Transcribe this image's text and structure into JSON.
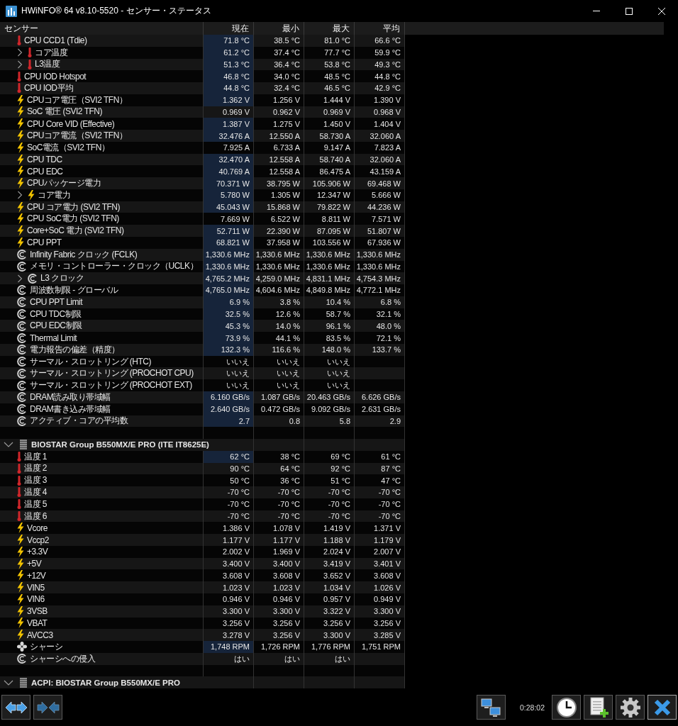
{
  "window": {
    "title": "HWiNFO® 64 v8.10-5520 - センサー・ステータス"
  },
  "columns": [
    "センサー",
    "現在",
    "最小",
    "最大",
    "平均"
  ],
  "sections": [
    {
      "rows": [
        {
          "kind": "temperature",
          "label": "CPU CCD1 (Tdie)",
          "collapsed": false,
          "current": "71.8 °C",
          "min": "38.5 °C",
          "max": "81.0 °C",
          "avg": "66.6 °C",
          "highlighted": true
        },
        {
          "kind": "temperature",
          "label": "コア温度",
          "collapsed": true,
          "current": "61.2 °C",
          "min": "37.4 °C",
          "max": "77.7 °C",
          "avg": "59.9 °C",
          "highlighted": true
        },
        {
          "kind": "temperature",
          "label": "L3温度",
          "collapsed": true,
          "current": "51.3 °C",
          "min": "36.4 °C",
          "max": "53.8 °C",
          "avg": "49.3 °C",
          "highlighted": true
        },
        {
          "kind": "temperature",
          "label": "CPU IOD Hotspot",
          "collapsed": false,
          "current": "46.8 °C",
          "min": "34.0 °C",
          "max": "48.5 °C",
          "avg": "44.8 °C",
          "highlighted": true
        },
        {
          "kind": "temperature",
          "label": "CPU IOD平均",
          "collapsed": false,
          "current": "44.8 °C",
          "min": "32.4 °C",
          "max": "46.5 °C",
          "avg": "42.9 °C",
          "highlighted": true
        },
        {
          "kind": "electric",
          "label": "CPUコア電圧（SVI2 TFN）",
          "collapsed": false,
          "current": "1.362 V",
          "min": "1.256 V",
          "max": "1.444 V",
          "avg": "1.390 V",
          "highlighted": true
        },
        {
          "kind": "electric",
          "label": "SoC 電圧 (SVI2 TFN)",
          "collapsed": false,
          "current": "0.969 V",
          "min": "0.962 V",
          "max": "0.969 V",
          "avg": "0.968 V",
          "highlighted": false
        },
        {
          "kind": "electric",
          "label": "CPU Core VID (Effective)",
          "collapsed": false,
          "current": "1.387 V",
          "min": "1.275 V",
          "max": "1.450 V",
          "avg": "1.404 V",
          "highlighted": true
        },
        {
          "kind": "electric",
          "label": "CPUコア電流（SVI2 TFN）",
          "collapsed": false,
          "current": "32.476 A",
          "min": "12.550 A",
          "max": "58.730 A",
          "avg": "32.060 A",
          "highlighted": true
        },
        {
          "kind": "electric",
          "label": "SoC電流（SVI2 TFN）",
          "collapsed": false,
          "current": "7.925 A",
          "min": "6.733 A",
          "max": "9.147 A",
          "avg": "7.823 A",
          "highlighted": false
        },
        {
          "kind": "electric",
          "label": "CPU TDC",
          "collapsed": false,
          "current": "32.470 A",
          "min": "12.558 A",
          "max": "58.740 A",
          "avg": "32.060 A",
          "highlighted": true
        },
        {
          "kind": "electric",
          "label": "CPU EDC",
          "collapsed": false,
          "current": "40.769 A",
          "min": "12.558 A",
          "max": "86.475 A",
          "avg": "43.159 A",
          "highlighted": true
        },
        {
          "kind": "electric",
          "label": "CPUパッケージ電力",
          "collapsed": false,
          "current": "70.371 W",
          "min": "38.795 W",
          "max": "105.906 W",
          "avg": "69.468 W",
          "highlighted": true
        },
        {
          "kind": "electric",
          "label": "コア電力",
          "collapsed": true,
          "current": "5.780 W",
          "min": "1.305 W",
          "max": "12.347 W",
          "avg": "5.666 W",
          "highlighted": true
        },
        {
          "kind": "electric",
          "label": "CPU コア電力 (SVI2 TFN)",
          "collapsed": false,
          "current": "45.043 W",
          "min": "15.868 W",
          "max": "79.822 W",
          "avg": "44.236 W",
          "highlighted": true
        },
        {
          "kind": "electric",
          "label": "CPU SoC電力 (SVI2 TFN)",
          "collapsed": false,
          "current": "7.669 W",
          "min": "6.522 W",
          "max": "8.811 W",
          "avg": "7.571 W",
          "highlighted": false
        },
        {
          "kind": "electric",
          "label": "Core+SoC 電力 (SVI2 TFN)",
          "collapsed": false,
          "current": "52.711 W",
          "min": "22.390 W",
          "max": "87.095 W",
          "avg": "51.807 W",
          "highlighted": true
        },
        {
          "kind": "electric",
          "label": "CPU PPT",
          "collapsed": false,
          "current": "68.821 W",
          "min": "37.958 W",
          "max": "103.556 W",
          "avg": "67.936 W",
          "highlighted": true
        },
        {
          "kind": "other",
          "label": "Infinity Fabric クロック (FCLK)",
          "collapsed": false,
          "current": "1,330.6 MHz",
          "min": "1,330.6 MHz",
          "max": "1,330.6 MHz",
          "avg": "1,330.6 MHz",
          "highlighted": true
        },
        {
          "kind": "other",
          "label": "メモリ・コントローラー・クロック（UCLK）",
          "collapsed": false,
          "current": "1,330.6 MHz",
          "min": "1,330.6 MHz",
          "max": "1,330.6 MHz",
          "avg": "1,330.6 MHz",
          "highlighted": true
        },
        {
          "kind": "other",
          "label": "L3 クロック",
          "collapsed": true,
          "current": "4,765.2 MHz",
          "min": "4,259.0 MHz",
          "max": "4,831.1 MHz",
          "avg": "4,754.3 MHz",
          "highlighted": true
        },
        {
          "kind": "other",
          "label": "周波数制限 - グローバル",
          "collapsed": false,
          "current": "4,765.0 MHz",
          "min": "4,604.6 MHz",
          "max": "4,849.8 MHz",
          "avg": "4,772.1 MHz",
          "highlighted": true
        },
        {
          "kind": "other",
          "label": "CPU PPT Limit",
          "collapsed": false,
          "current": "6.9 %",
          "min": "3.8 %",
          "max": "10.4 %",
          "avg": "6.8 %",
          "highlighted": true
        },
        {
          "kind": "other",
          "label": "CPU TDC制限",
          "collapsed": false,
          "current": "32.5 %",
          "min": "12.6 %",
          "max": "58.7 %",
          "avg": "32.1 %",
          "highlighted": true
        },
        {
          "kind": "other",
          "label": "CPU EDC制限",
          "collapsed": false,
          "current": "45.3 %",
          "min": "14.0 %",
          "max": "96.1 %",
          "avg": "48.0 %",
          "highlighted": true
        },
        {
          "kind": "other",
          "label": "Thermal Limit",
          "collapsed": false,
          "current": "73.9 %",
          "min": "44.1 %",
          "max": "83.5 %",
          "avg": "72.1 %",
          "highlighted": true
        },
        {
          "kind": "other",
          "label": "電力報告の偏差（精度）",
          "collapsed": false,
          "current": "132.3 %",
          "min": "116.6 %",
          "max": "148.0 %",
          "avg": "133.7 %",
          "highlighted": true
        },
        {
          "kind": "other",
          "label": "サーマル・スロットリング (HTC)",
          "collapsed": false,
          "current": "いいえ",
          "min": "いいえ",
          "max": "いいえ",
          "highlighted": false
        },
        {
          "kind": "other",
          "label": "サーマル・スロットリング (PROCHOT CPU)",
          "collapsed": false,
          "current": "いいえ",
          "min": "いいえ",
          "max": "いいえ",
          "highlighted": false
        },
        {
          "kind": "other",
          "label": "サーマル・スロットリング (PROCHOT EXT)",
          "collapsed": false,
          "current": "いいえ",
          "min": "いいえ",
          "max": "いいえ",
          "highlighted": false
        },
        {
          "kind": "other",
          "label": "DRAM読み取り帯域幅",
          "collapsed": false,
          "current": "6.160 GB/s",
          "min": "1.087 GB/s",
          "max": "20.463 GB/s",
          "avg": "6.626 GB/s",
          "highlighted": true
        },
        {
          "kind": "other",
          "label": "DRAM書き込み帯域幅",
          "collapsed": false,
          "current": "2.640 GB/s",
          "min": "0.472 GB/s",
          "max": "9.092 GB/s",
          "avg": "2.631 GB/s",
          "highlighted": true
        },
        {
          "kind": "other",
          "label": "アクティブ・コアの平均数",
          "collapsed": false,
          "current": "2.7",
          "min": "0.8",
          "max": "5.8",
          "avg": "2.9",
          "highlighted": true
        }
      ]
    },
    {
      "title": "BIOSTAR Group B550MX/E PRO (ITE IT8625E)",
      "expanded": true,
      "rows": [
        {
          "kind": "temperature",
          "label": "温度 1",
          "collapsed": false,
          "current": "62 °C",
          "min": "38 °C",
          "max": "69 °C",
          "avg": "61 °C",
          "highlighted": true
        },
        {
          "kind": "temperature",
          "label": "温度 2",
          "collapsed": false,
          "current": "90 °C",
          "min": "64 °C",
          "max": "92 °C",
          "avg": "87 °C",
          "highlighted": false
        },
        {
          "kind": "temperature",
          "label": "温度 3",
          "collapsed": false,
          "current": "50 °C",
          "min": "36 °C",
          "max": "51 °C",
          "avg": "47 °C",
          "highlighted": false
        },
        {
          "kind": "temperature",
          "label": "温度 4",
          "collapsed": false,
          "current": "-70 °C",
          "min": "-70 °C",
          "max": "-70 °C",
          "avg": "-70 °C",
          "highlighted": false
        },
        {
          "kind": "temperature",
          "label": "温度 5",
          "collapsed": false,
          "current": "-70 °C",
          "min": "-70 °C",
          "max": "-70 °C",
          "avg": "-70 °C",
          "highlighted": false
        },
        {
          "kind": "temperature",
          "label": "温度 6",
          "collapsed": false,
          "current": "-70 °C",
          "min": "-70 °C",
          "max": "-70 °C",
          "avg": "-70 °C",
          "highlighted": false
        },
        {
          "kind": "electric",
          "label": "Vcore",
          "collapsed": false,
          "current": "1.386 V",
          "min": "1.078 V",
          "max": "1.419 V",
          "avg": "1.371 V",
          "highlighted": false
        },
        {
          "kind": "electric",
          "label": "Vccp2",
          "collapsed": false,
          "current": "1.177 V",
          "min": "1.177 V",
          "max": "1.188 V",
          "avg": "1.179 V",
          "highlighted": false
        },
        {
          "kind": "electric",
          "label": "+3.3V",
          "collapsed": false,
          "current": "2.002 V",
          "min": "1.969 V",
          "max": "2.024 V",
          "avg": "2.007 V",
          "highlighted": false
        },
        {
          "kind": "electric",
          "label": "+5V",
          "collapsed": false,
          "current": "3.400 V",
          "min": "3.400 V",
          "max": "3.419 V",
          "avg": "3.401 V",
          "highlighted": false
        },
        {
          "kind": "electric",
          "label": "+12V",
          "collapsed": false,
          "current": "3.608 V",
          "min": "3.608 V",
          "max": "3.652 V",
          "avg": "3.608 V",
          "highlighted": false
        },
        {
          "kind": "electric",
          "label": "VIN5",
          "collapsed": false,
          "current": "1.023 V",
          "min": "1.023 V",
          "max": "1.034 V",
          "avg": "1.026 V",
          "highlighted": false
        },
        {
          "kind": "electric",
          "label": "VIN6",
          "collapsed": false,
          "current": "0.946 V",
          "min": "0.946 V",
          "max": "0.957 V",
          "avg": "0.949 V",
          "highlighted": false
        },
        {
          "kind": "electric",
          "label": "3VSB",
          "collapsed": false,
          "current": "3.300 V",
          "min": "3.300 V",
          "max": "3.322 V",
          "avg": "3.300 V",
          "highlighted": false
        },
        {
          "kind": "electric",
          "label": "VBAT",
          "collapsed": false,
          "current": "3.256 V",
          "min": "3.256 V",
          "max": "3.256 V",
          "avg": "3.256 V",
          "highlighted": false
        },
        {
          "kind": "electric",
          "label": "AVCC3",
          "collapsed": false,
          "current": "3.278 V",
          "min": "3.256 V",
          "max": "3.300 V",
          "avg": "3.285 V",
          "highlighted": false
        },
        {
          "kind": "fan",
          "label": "シャーシ",
          "collapsed": false,
          "current": "1,748 RPM",
          "min": "1,726 RPM",
          "max": "1,776 RPM",
          "avg": "1,751 RPM",
          "highlighted": true
        },
        {
          "kind": "other",
          "label": "シャーシへの侵入",
          "collapsed": false,
          "current": "はい",
          "min": "はい",
          "max": "はい",
          "highlighted": false
        }
      ]
    },
    {
      "title": "ACPI: BIOSTAR Group B550MX/E PRO",
      "expanded": true
    }
  ],
  "status": {
    "elapsed": "0:28:02"
  }
}
